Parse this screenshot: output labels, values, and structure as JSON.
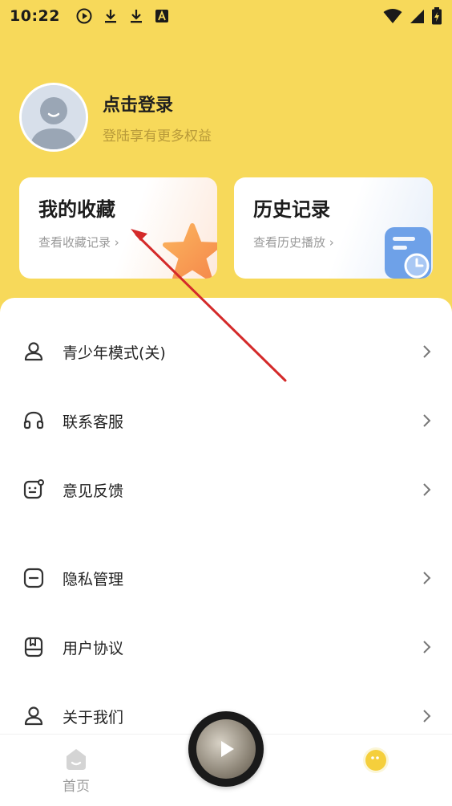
{
  "status_bar": {
    "time": "10:22",
    "icons_left": [
      "play-circle-icon",
      "download-icon",
      "download-icon",
      "a-badge-icon"
    ],
    "icons_right": [
      "wifi-icon",
      "signal-icon",
      "battery-charging-icon"
    ]
  },
  "profile": {
    "title": "点击登录",
    "subtitle": "登陆享有更多权益"
  },
  "cards": {
    "favorites": {
      "title": "我的收藏",
      "subtitle": "查看收藏记录 ›"
    },
    "history": {
      "title": "历史记录",
      "subtitle": "查看历史播放 ›"
    }
  },
  "menu": {
    "items": [
      {
        "label": "青少年模式(关)",
        "icon": "teen-mode-icon"
      },
      {
        "label": "联系客服",
        "icon": "headset-icon"
      },
      {
        "label": "意见反馈",
        "icon": "feedback-icon"
      },
      {
        "label": "隐私管理",
        "icon": "privacy-icon"
      },
      {
        "label": "用户协议",
        "icon": "agreement-icon"
      },
      {
        "label": "关于我们",
        "icon": "about-icon"
      }
    ]
  },
  "bottom_nav": {
    "home_label": "首页"
  },
  "colors": {
    "background_yellow": "#f7d95a",
    "annotation_arrow": "#d42a2a"
  }
}
